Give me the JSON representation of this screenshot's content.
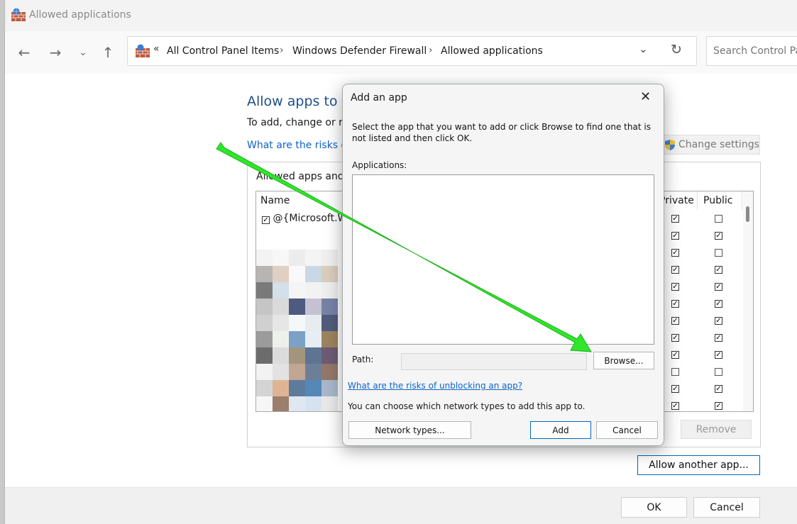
{
  "window": {
    "title": "Allowed applications",
    "address": {
      "crumbs": [
        "All Control Panel Items",
        "Windows Defender Firewall",
        "Allowed applications"
      ]
    },
    "search_placeholder": "Search Control Panel"
  },
  "main": {
    "heading": "Allow apps to c",
    "subtext": "To add, change or re",
    "risk_link": "What are the risks of",
    "change_settings": "Change settings",
    "group_label": "Allowed apps and",
    "columns": {
      "name": "Name",
      "private": "Private",
      "public": "Public"
    },
    "first_row_name": "@{Microsoft.Wi",
    "rows": [
      {
        "private": true,
        "public": false
      },
      {
        "private": true,
        "public": true
      },
      {
        "private": true,
        "public": false
      },
      {
        "private": true,
        "public": true
      },
      {
        "private": true,
        "public": true
      },
      {
        "private": true,
        "public": true
      },
      {
        "private": true,
        "public": true
      },
      {
        "private": true,
        "public": true
      },
      {
        "private": true,
        "public": true
      },
      {
        "private": false,
        "public": false
      },
      {
        "private": true,
        "public": true
      },
      {
        "private": true,
        "public": true
      }
    ],
    "remove_button": "Remove",
    "allow_another_button": "Allow another app..."
  },
  "footer": {
    "ok": "OK",
    "cancel": "Cancel"
  },
  "dialog": {
    "title": "Add an app",
    "instructions": "Select the app that you want to add or click Browse to find one that is not listed and then click OK.",
    "applications_label": "Applications:",
    "path_label": "Path:",
    "path_value": "",
    "browse_button": "Browse...",
    "risk_link": "What are the risks of unblocking an app?",
    "network_text": "You can choose which network types to add this app to.",
    "network_types_button": "Network types...",
    "add_button": "Add",
    "cancel_button": "Cancel"
  },
  "colors": {
    "link": "#0f63c9",
    "heading": "#1e4e8c",
    "accent_border": "#0067c0",
    "annotation_arrow": "#2ee62a"
  },
  "mosaic": [
    [
      "#f3f3f3",
      "#f7f7f7",
      "#ececec",
      "#f4f4f4",
      "#efefef"
    ],
    [
      "#b7b5b4",
      "#e0d0c3",
      "#f9f9f9",
      "#c9d8e4",
      "#d9cdbd"
    ],
    [
      "#7a7a7a",
      "#d3dfe9",
      "#f5f5f5",
      "#f2f2f2",
      "#eeeeee"
    ],
    [
      "#c5c5c5",
      "#dadada",
      "#4e5a80",
      "#c4c1d2",
      "#7583a6"
    ],
    [
      "#d0d0d0",
      "#e6e6e6",
      "#f5f7f9",
      "#e8ecef",
      "#4f5d7c"
    ],
    [
      "#9b9b9b",
      "#eef0ea",
      "#7ba1c7",
      "#e6eef4",
      "#9c835e"
    ],
    [
      "#6c6c6c",
      "#dcdcdc",
      "#a2957c",
      "#5d7592",
      "#6c5b73"
    ],
    [
      "#f2f2f2",
      "#e2e2e2",
      "#c1a692",
      "#6d7f98",
      "#94776b"
    ],
    [
      "#d4d4d4",
      "#ddb595",
      "#5e7b9c",
      "#5587b7",
      "#a9b7cb"
    ],
    [
      "#f6f6f6",
      "#9b7e6c",
      "#dfe8f1",
      "#d5e3f0",
      "#e9e9e9"
    ]
  ]
}
